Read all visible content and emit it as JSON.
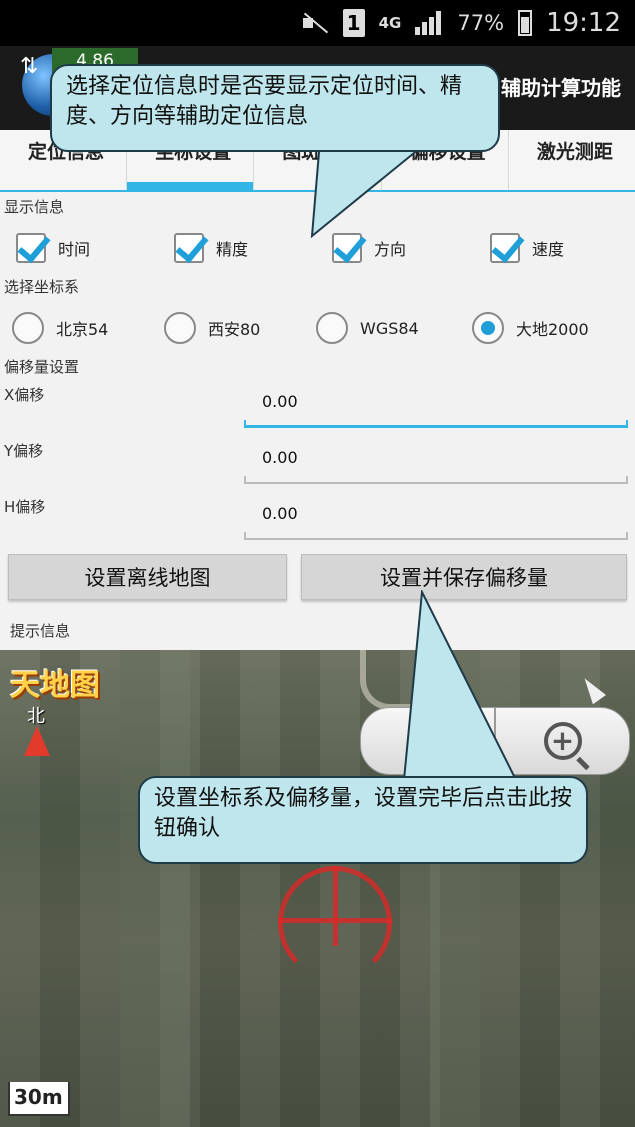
{
  "status_bar": {
    "sim_slot": "1",
    "network": "4G",
    "battery": "77%",
    "time": "19:12"
  },
  "action_bar": {
    "badge": "4.86",
    "title_tail": "辅助计算功能"
  },
  "tabs": [
    {
      "label": "定位信息",
      "active": false
    },
    {
      "label": "坐标设置",
      "active": true
    },
    {
      "label": "图斑计算",
      "active": false
    },
    {
      "label": "偏移设置",
      "active": false
    },
    {
      "label": "激光测距",
      "active": false
    }
  ],
  "display_info": {
    "label": "显示信息",
    "options": [
      {
        "label": "时间",
        "checked": true
      },
      {
        "label": "精度",
        "checked": true
      },
      {
        "label": "方向",
        "checked": true
      },
      {
        "label": "速度",
        "checked": true
      }
    ]
  },
  "coord_system": {
    "label": "选择坐标系",
    "options": [
      {
        "label": "北京54",
        "selected": false
      },
      {
        "label": "西安80",
        "selected": false
      },
      {
        "label": "WGS84",
        "selected": false
      },
      {
        "label": "大地2000",
        "selected": true
      }
    ]
  },
  "offset": {
    "label": "偏移量设置",
    "fields": [
      {
        "label": "X偏移",
        "value": "0.00"
      },
      {
        "label": "Y偏移",
        "value": "0.00"
      },
      {
        "label": "H偏移",
        "value": "0.00"
      }
    ]
  },
  "buttons": {
    "offline_map": "设置离线地图",
    "save_offset": "设置并保存偏移量"
  },
  "hint_label": "提示信息",
  "map": {
    "logo": "天地图",
    "north": "北",
    "scale": "30m"
  },
  "callouts": {
    "top": "选择定位信息时是否要显示定位时间、精度、方向等辅助定位信息",
    "bottom": "设置坐标系及偏移量，设置完毕后点击此按钮确认"
  },
  "colors": {
    "accent": "#33b5e5",
    "callout_fill": "#bfe6ec",
    "crosshair": "#dc2828"
  }
}
